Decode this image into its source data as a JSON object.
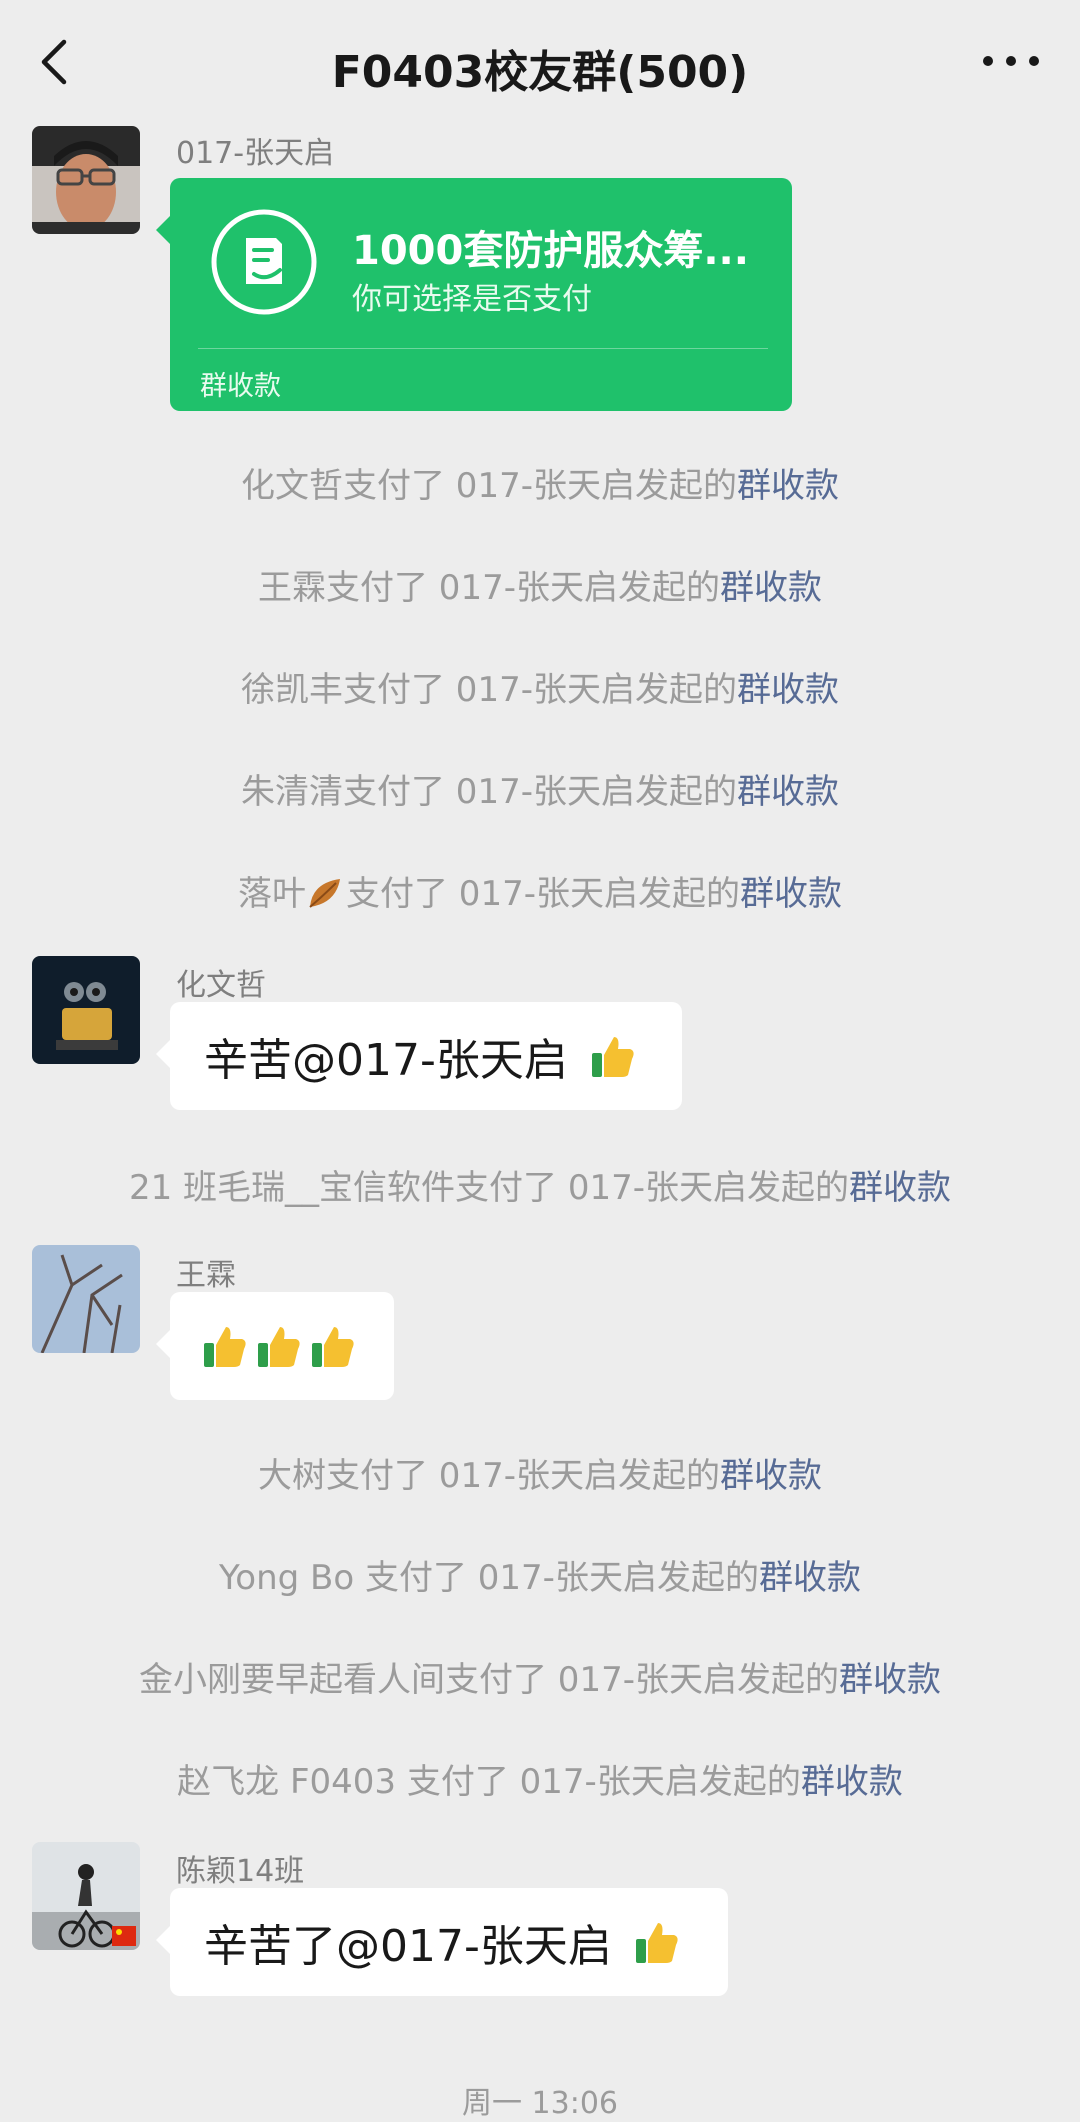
{
  "header": {
    "title": "F0403校友群(500)"
  },
  "messages": {
    "m1": {
      "sender": "017-张天启",
      "card": {
        "title": "1000套防护服众筹...",
        "subtitle": "你可选择是否支付",
        "footer": "群收款"
      }
    },
    "m2": {
      "sender": "化文哲",
      "text": "辛苦@017-张天启"
    },
    "m3": {
      "sender": "王霖"
    },
    "m4": {
      "sender": "陈颖14班",
      "text": "辛苦了@017-张天启"
    }
  },
  "system": {
    "link_label": "群收款",
    "s1": "化文哲支付了 017-张天启发起的",
    "s2": "王霖支付了 017-张天启发起的",
    "s3": "徐凯丰支付了 017-张天启发起的",
    "s4": "朱清清支付了 017-张天启发起的",
    "s5a": "落叶",
    "s5b": "支付了 017-张天启发起的",
    "s6": "21 班毛瑞__宝信软件支付了 017-张天启发起的",
    "s7": "大树支付了 017-张天启发起的",
    "s8": "Yong Bo 支付了 017-张天启发起的",
    "s9": "金小刚要早起看人间支付了 017-张天启发起的",
    "s10": "赵飞龙 F0403 支付了 017-张天启发起的"
  },
  "timestamp": "周一 13:06",
  "colors": {
    "background": "#ededed",
    "payment_green": "#1fc16b",
    "link_blue": "#576b95",
    "system_gray": "#9b9b9b"
  },
  "icons": [
    "back-icon",
    "more-icon",
    "payment-icon",
    "thumbs-up-icon",
    "leaf-icon"
  ]
}
